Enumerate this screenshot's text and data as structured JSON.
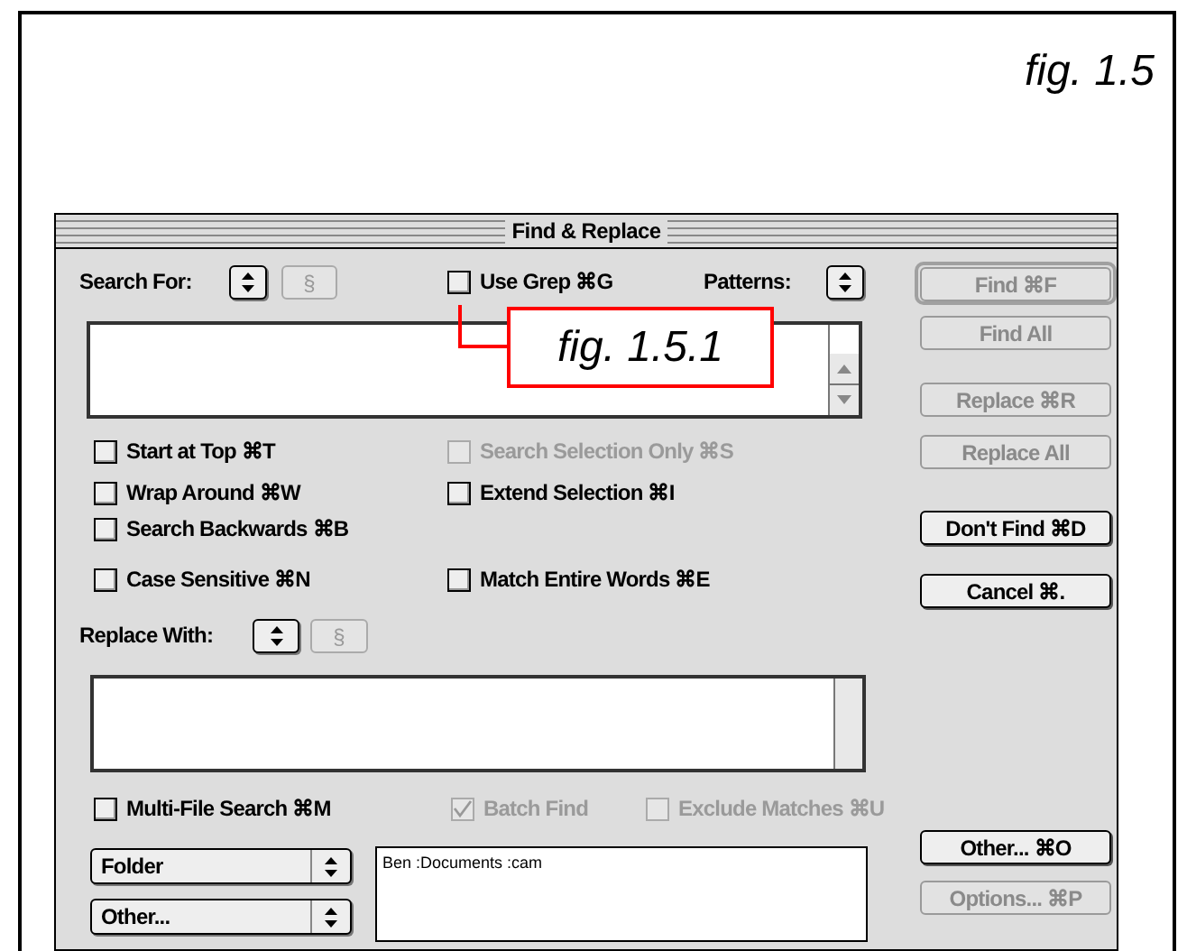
{
  "figure_label": "fig. 1.5",
  "callout": {
    "label": "fig. 1.5.1"
  },
  "window": {
    "title": "Find & Replace"
  },
  "search": {
    "label": "Search For:",
    "special_button": {
      "label": "§",
      "disabled": true
    },
    "use_grep": {
      "label": "Use Grep ⌘G",
      "checked": false,
      "disabled": false
    },
    "patterns_label": "Patterns:"
  },
  "option_rows": [
    [
      {
        "label": "Start at Top ⌘T",
        "checked": false,
        "disabled": false
      },
      {
        "label": "Search Selection Only ⌘S",
        "checked": false,
        "disabled": true
      }
    ],
    [
      {
        "label": "Wrap Around ⌘W",
        "checked": false,
        "disabled": false
      },
      {
        "label": "Extend Selection ⌘I",
        "checked": false,
        "disabled": false
      }
    ],
    [
      {
        "label": "Search Backwards ⌘B",
        "checked": false,
        "disabled": false
      }
    ],
    [
      {
        "label": "Case Sensitive ⌘N",
        "checked": false,
        "disabled": false
      },
      {
        "label": "Match Entire Words ⌘E",
        "checked": false,
        "disabled": false
      }
    ]
  ],
  "replace": {
    "label": "Replace With:",
    "special_button": {
      "label": "§",
      "disabled": true
    }
  },
  "batch_options": [
    {
      "label": "Multi-File Search ⌘M",
      "checked": false,
      "disabled": false
    },
    {
      "label": "Batch Find",
      "checked": true,
      "disabled": true
    },
    {
      "label": "Exclude Matches ⌘U",
      "checked": false,
      "disabled": true
    }
  ],
  "popups": [
    {
      "label": "Folder"
    },
    {
      "label": "Other..."
    }
  ],
  "file_list": [
    "Ben :Documents :cam"
  ],
  "buttons": [
    {
      "label": "Find ⌘F",
      "disabled": true,
      "default": true
    },
    {
      "label": "Find All",
      "disabled": true,
      "default": false
    },
    {
      "label": "Replace ⌘R",
      "disabled": true,
      "default": false
    },
    {
      "label": "Replace All",
      "disabled": true,
      "default": false
    },
    {
      "label": "Don't Find ⌘D",
      "disabled": false,
      "default": false
    },
    {
      "label": "Cancel ⌘.",
      "disabled": false,
      "default": false
    },
    {
      "label": "Other... ⌘O",
      "disabled": false,
      "default": false
    },
    {
      "label": "Options... ⌘P",
      "disabled": true,
      "default": false
    }
  ]
}
